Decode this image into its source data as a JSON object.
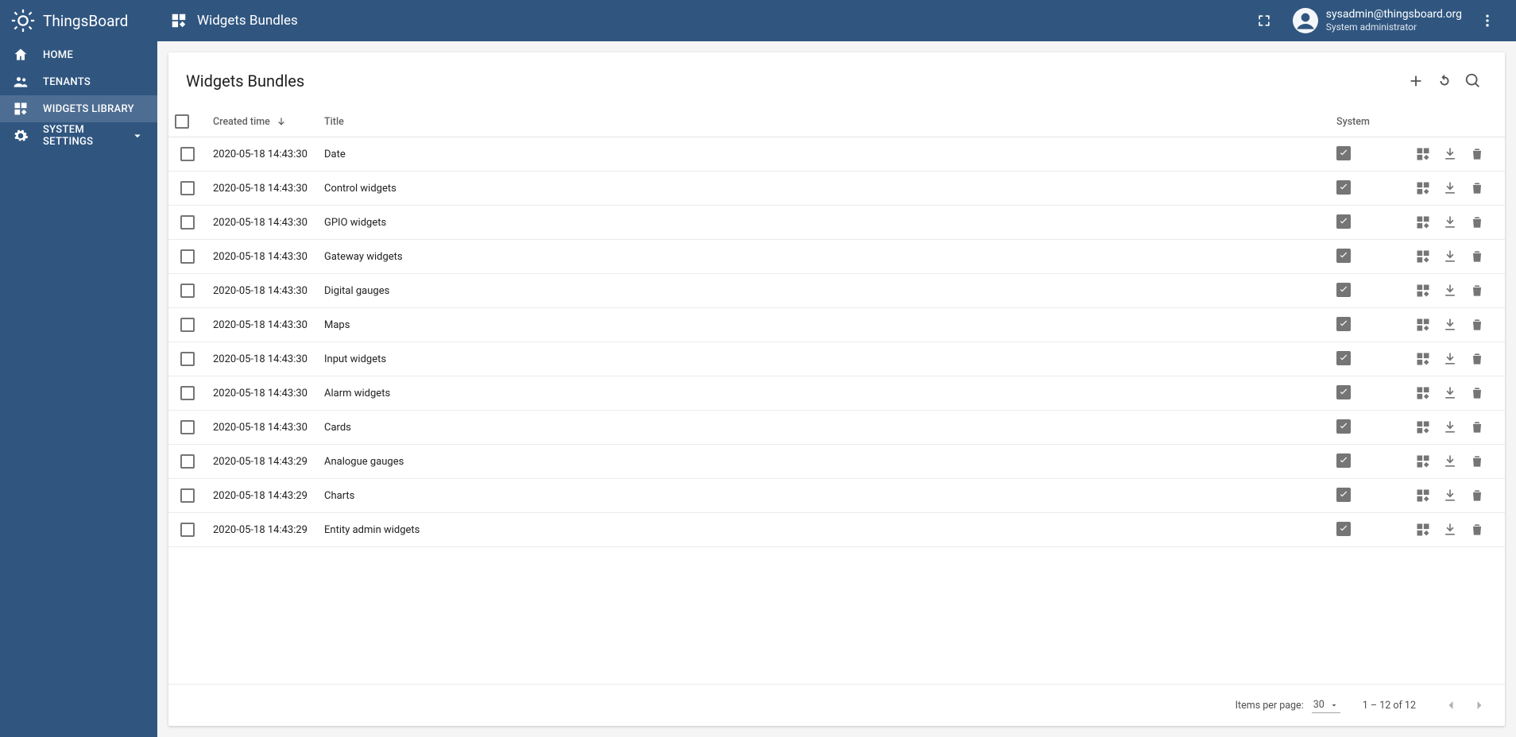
{
  "brand": "ThingsBoard",
  "topbar": {
    "title": "Widgets Bundles",
    "user_email": "sysadmin@thingsboard.org",
    "user_role": "System administrator"
  },
  "sidebar": {
    "items": [
      {
        "label": "HOME",
        "icon": "home",
        "active": false,
        "expandable": false
      },
      {
        "label": "TENANTS",
        "icon": "people",
        "active": false,
        "expandable": false
      },
      {
        "label": "WIDGETS LIBRARY",
        "icon": "widgets",
        "active": true,
        "expandable": false
      },
      {
        "label": "SYSTEM SETTINGS",
        "icon": "settings",
        "active": false,
        "expandable": true
      }
    ]
  },
  "card": {
    "title": "Widgets Bundles"
  },
  "table": {
    "columns": {
      "created": "Created time",
      "title": "Title",
      "system": "System"
    },
    "rows": [
      {
        "created": "2020-05-18 14:43:30",
        "title": "Date",
        "system": true
      },
      {
        "created": "2020-05-18 14:43:30",
        "title": "Control widgets",
        "system": true
      },
      {
        "created": "2020-05-18 14:43:30",
        "title": "GPIO widgets",
        "system": true
      },
      {
        "created": "2020-05-18 14:43:30",
        "title": "Gateway widgets",
        "system": true
      },
      {
        "created": "2020-05-18 14:43:30",
        "title": "Digital gauges",
        "system": true
      },
      {
        "created": "2020-05-18 14:43:30",
        "title": "Maps",
        "system": true
      },
      {
        "created": "2020-05-18 14:43:30",
        "title": "Input widgets",
        "system": true
      },
      {
        "created": "2020-05-18 14:43:30",
        "title": "Alarm widgets",
        "system": true
      },
      {
        "created": "2020-05-18 14:43:30",
        "title": "Cards",
        "system": true
      },
      {
        "created": "2020-05-18 14:43:29",
        "title": "Analogue gauges",
        "system": true
      },
      {
        "created": "2020-05-18 14:43:29",
        "title": "Charts",
        "system": true
      },
      {
        "created": "2020-05-18 14:43:29",
        "title": "Entity admin widgets",
        "system": true
      }
    ]
  },
  "paginator": {
    "items_per_page_label": "Items per page:",
    "page_size": "30",
    "range": "1 – 12 of 12"
  }
}
